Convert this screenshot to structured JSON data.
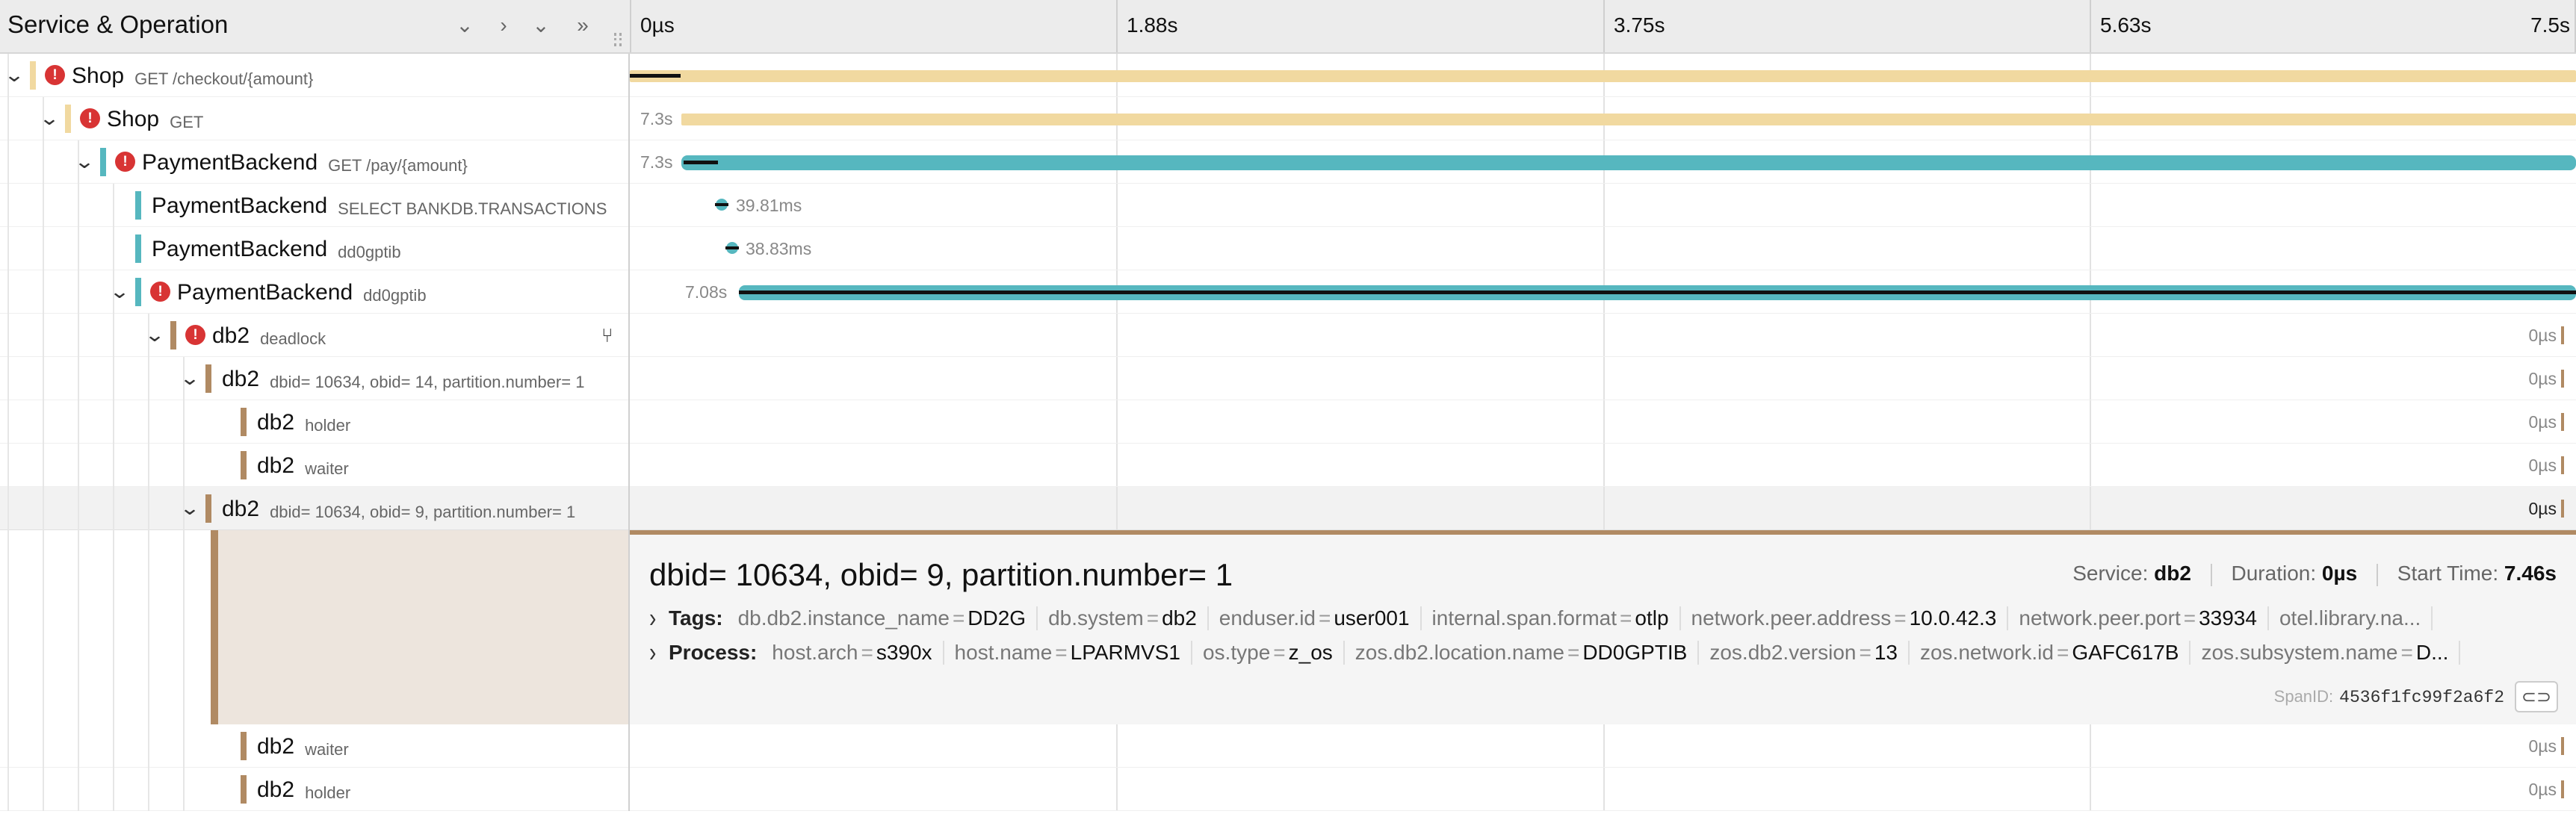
{
  "header": {
    "title": "Service & Operation",
    "ticks": [
      "0µs",
      "1.88s",
      "3.75s",
      "5.63s",
      "7.5s"
    ]
  },
  "colors": {
    "shop": "#f1d9a0",
    "payment": "#56b7bf",
    "db2": "#b08a63",
    "error": "#d83434"
  },
  "rows": [
    {
      "service": "Shop",
      "operation": "GET /checkout/{amount}",
      "duration": ""
    },
    {
      "service": "Shop",
      "operation": "GET",
      "duration": "7.3s"
    },
    {
      "service": "PaymentBackend",
      "operation": "GET /pay/{amount}",
      "duration": "7.3s"
    },
    {
      "service": "PaymentBackend",
      "operation": "SELECT BANKDB.TRANSACTIONS",
      "duration": "39.81ms"
    },
    {
      "service": "PaymentBackend",
      "operation": "dd0gptib",
      "duration": "38.83ms"
    },
    {
      "service": "PaymentBackend",
      "operation": "dd0gptib",
      "duration": "7.08s"
    },
    {
      "service": "db2",
      "operation": "deadlock",
      "duration": "0µs"
    },
    {
      "service": "db2",
      "operation": "dbid= 10634, obid= 14, partition.number= 1",
      "duration": "0µs"
    },
    {
      "service": "db2",
      "operation": "holder",
      "duration": "0µs"
    },
    {
      "service": "db2",
      "operation": "waiter",
      "duration": "0µs"
    },
    {
      "service": "db2",
      "operation": "dbid= 10634, obid= 9, partition.number= 1",
      "duration": "0µs"
    },
    {
      "service": "db2",
      "operation": "waiter",
      "duration": "0µs"
    },
    {
      "service": "db2",
      "operation": "holder",
      "duration": "0µs"
    }
  ],
  "detail": {
    "title": "dbid= 10634, obid= 9, partition.number= 1",
    "service_label": "Service:",
    "service": "db2",
    "duration_label": "Duration:",
    "duration": "0µs",
    "start_label": "Start Time:",
    "start": "7.46s",
    "tags_label": "Tags:",
    "tags": [
      {
        "k": "db.db2.instance_name",
        "v": "DD2G"
      },
      {
        "k": "db.system",
        "v": "db2"
      },
      {
        "k": "enduser.id",
        "v": "user001"
      },
      {
        "k": "internal.span.format",
        "v": "otlp"
      },
      {
        "k": "network.peer.address",
        "v": "10.0.42.3"
      },
      {
        "k": "network.peer.port",
        "v": "33934"
      },
      {
        "k": "otel.library.na...",
        "v": ""
      }
    ],
    "process_label": "Process:",
    "process": [
      {
        "k": "host.arch",
        "v": "s390x"
      },
      {
        "k": "host.name",
        "v": "LPARMVS1"
      },
      {
        "k": "os.type",
        "v": "z_os"
      },
      {
        "k": "zos.db2.location.name",
        "v": "DD0GPTIB"
      },
      {
        "k": "zos.db2.version",
        "v": "13"
      },
      {
        "k": "zos.network.id",
        "v": "GAFC617B"
      },
      {
        "k": "zos.subsystem.name",
        "v": "D..."
      }
    ],
    "spanid_label": "SpanID:",
    "spanid": "4536f1fc99f2a6f2"
  }
}
